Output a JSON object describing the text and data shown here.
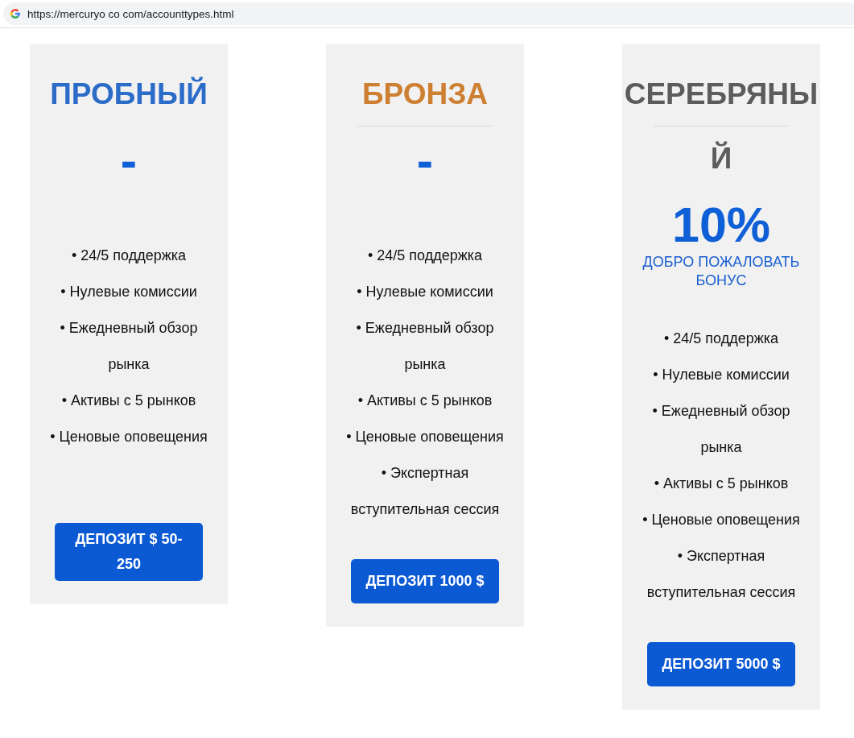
{
  "address_bar": {
    "url": "https://mercuryo co com/accounttypes.html"
  },
  "cards": [
    {
      "title": "ПРОБНЫЙ",
      "color": "#2b6cc9",
      "divider": false,
      "price": "-",
      "features": [
        "• 24/5 поддержка",
        "• Нулевые комиссии",
        "• Ежедневный обзор рынка",
        "• Активы с 5 рынков",
        "• Ценовые оповещения"
      ],
      "button": "ДЕПОЗИТ $ 50-250"
    },
    {
      "title": "БРОНЗА",
      "color": "#cd7f32",
      "divider": true,
      "price": "-",
      "features": [
        "• 24/5 поддержка",
        "• Нулевые комиссии",
        "• Ежедневный обзор рынка",
        "• Активы с 5 рынков",
        "• Ценовые оповещения",
        "• Экспертная вступительная сессия"
      ],
      "button": "ДЕПОЗИТ 1000 $"
    },
    {
      "title": "СЕРЕБРЯНЫЙ",
      "color": "#5c5c5c",
      "divider": true,
      "price": "10%",
      "bonus": "ДОБРО ПОЖАЛОВАТЬ БОНУС",
      "features": [
        "• 24/5 поддержка",
        "• Нулевые комиссии",
        "• Ежедневный обзор рынка",
        "• Активы с 5 рынков",
        "• Ценовые оповещения",
        "• Экспертная вступительная сессия"
      ],
      "button": "ДЕПОЗИТ 5000 $"
    }
  ]
}
